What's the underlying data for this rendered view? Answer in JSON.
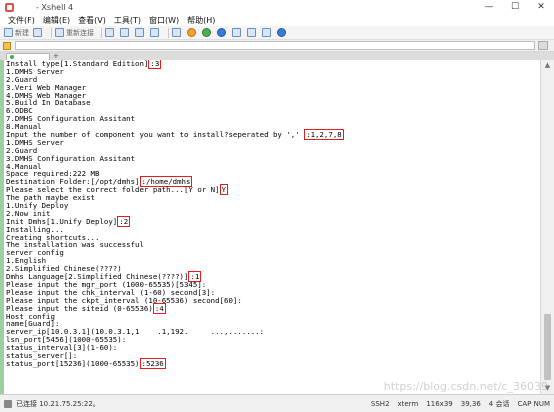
{
  "window": {
    "title": "- Xshell 4",
    "controls": [
      "—",
      "☐",
      "✕"
    ]
  },
  "menu": {
    "items": [
      "文件(F)",
      "编辑(E)",
      "查看(V)",
      "工具(T)",
      "窗口(W)",
      "帮助(H)"
    ]
  },
  "toolbar": {
    "new_label": "新建",
    "reconnect_label": "重新连接"
  },
  "tab": {
    "add_symbol": "+"
  },
  "terminal": {
    "lines": [
      {
        "pre": "Install type[1.Standard Edition]",
        "hl": ":3",
        "post": ""
      },
      {
        "pre": "1.DMHS Server",
        "hl": "",
        "post": ""
      },
      {
        "pre": "2.Guard",
        "hl": "",
        "post": ""
      },
      {
        "pre": "3.Veri Web Manager",
        "hl": "",
        "post": ""
      },
      {
        "pre": "4.DMHS Web Manager",
        "hl": "",
        "post": ""
      },
      {
        "pre": "5.Build In Database",
        "hl": "",
        "post": ""
      },
      {
        "pre": "6.ODBC",
        "hl": "",
        "post": ""
      },
      {
        "pre": "7.DMHS Configuration Assitant",
        "hl": "",
        "post": ""
      },
      {
        "pre": "8.Manual",
        "hl": "",
        "post": ""
      },
      {
        "pre": "Input the number of component you want to install?seperated by ',' ",
        "hl": ":1,2,7,8",
        "post": ""
      },
      {
        "pre": "1.DMHS Server",
        "hl": "",
        "post": ""
      },
      {
        "pre": "2.Guard",
        "hl": "",
        "post": ""
      },
      {
        "pre": "3.DMHS Configuration Assitant",
        "hl": "",
        "post": ""
      },
      {
        "pre": "4.Manual",
        "hl": "",
        "post": ""
      },
      {
        "pre": "Space required:222 MB",
        "hl": "",
        "post": ""
      },
      {
        "pre": "Destination Folder:[/opt/dmhs]",
        "hl": ":/home/dmhs",
        "post": ""
      },
      {
        "pre": "Please select the correct folder path...[Y or N]",
        "hl": "Y",
        "post": ""
      },
      {
        "pre": "The path maybe exist",
        "hl": "",
        "post": ""
      },
      {
        "pre": "1.Unify Deploy",
        "hl": "",
        "post": ""
      },
      {
        "pre": "2.Now init",
        "hl": "",
        "post": ""
      },
      {
        "pre": "Init Dmhs[1.Unify Deploy]",
        "hl": ":2",
        "post": ""
      },
      {
        "pre": "Installing...",
        "hl": "",
        "post": ""
      },
      {
        "pre": "Creating shortcuts...",
        "hl": "",
        "post": ""
      },
      {
        "pre": "The installation was successful",
        "hl": "",
        "post": ""
      },
      {
        "pre": "server config",
        "hl": "",
        "post": ""
      },
      {
        "pre": "1.English",
        "hl": "",
        "post": ""
      },
      {
        "pre": "2.Simplified Chinese(????)",
        "hl": "",
        "post": ""
      },
      {
        "pre": "Dmhs Language[2.Simplified Chinese(????)]",
        "hl": ":1",
        "post": ""
      },
      {
        "pre": "Please input the mgr_port (1000-65535)[5345]:",
        "hl": "",
        "post": ""
      },
      {
        "pre": "Please input the chk_interval (1-60) second[3]:",
        "hl": "",
        "post": ""
      },
      {
        "pre": "Please input the ckpt_interval (10-65536) second[60]:",
        "hl": "",
        "post": ""
      },
      {
        "pre": "Please input the siteid (0-65536)",
        "hl": ":4",
        "post": ""
      },
      {
        "pre": "Host config",
        "hl": "",
        "post": ""
      },
      {
        "pre": "name[Guard]:",
        "hl": "",
        "post": ""
      },
      {
        "pre": "server_ip[10.0.3.1](10.0.3.1,1    .1,192.     ...,.......:",
        "hl": "",
        "post": ""
      },
      {
        "pre": "lsn_port[5456](1000-65535):",
        "hl": "",
        "post": ""
      },
      {
        "pre": "status_interval[3](1-60):",
        "hl": "",
        "post": ""
      },
      {
        "pre": "status_server[]:",
        "hl": "",
        "post": ""
      },
      {
        "pre": "status_port[15236](1000-65535)",
        "hl": ":5236",
        "post": ""
      }
    ]
  },
  "statusbar": {
    "connection": "已连接 10.21.75.25:22。",
    "protocol": "SSH2",
    "term": "xterm",
    "size": "116x39",
    "cursor": "39,36",
    "sessions": "4 会话",
    "caps": "CAP NUM"
  },
  "watermark": "https://blog.csdn.net/c_36039"
}
